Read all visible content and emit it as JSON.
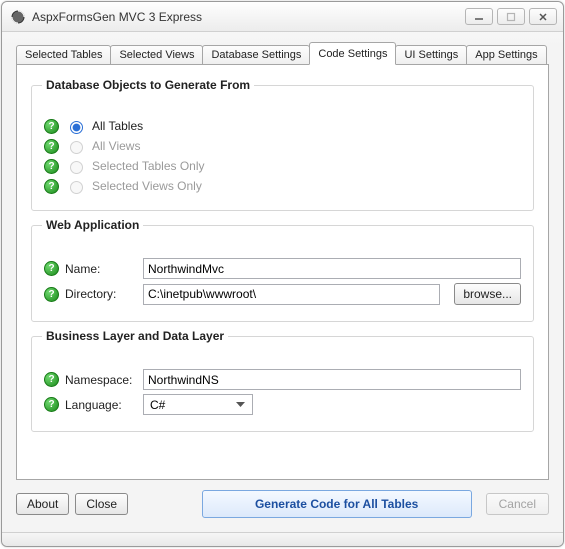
{
  "window": {
    "title": "AspxFormsGen MVC 3 Express"
  },
  "tabs": [
    {
      "label": "Selected Tables"
    },
    {
      "label": "Selected Views"
    },
    {
      "label": "Database Settings"
    },
    {
      "label": "Code Settings"
    },
    {
      "label": "UI Settings"
    },
    {
      "label": "App Settings"
    }
  ],
  "active_tab_index": 3,
  "dbobjects": {
    "title": "Database Objects to Generate From",
    "options": [
      {
        "label": "All Tables",
        "selected": true,
        "enabled": true
      },
      {
        "label": "All Views",
        "selected": false,
        "enabled": false
      },
      {
        "label": "Selected Tables Only",
        "selected": false,
        "enabled": false
      },
      {
        "label": "Selected Views Only",
        "selected": false,
        "enabled": false
      }
    ]
  },
  "webapp": {
    "title": "Web Application",
    "name_label": "Name:",
    "name_value": "NorthwindMvc",
    "dir_label": "Directory:",
    "dir_value": "C:\\inetpub\\wwwroot\\",
    "browse_label": "browse..."
  },
  "layers": {
    "title": "Business Layer and Data Layer",
    "ns_label": "Namespace:",
    "ns_value": "NorthwindNS",
    "lang_label": "Language:",
    "lang_value": "C#"
  },
  "footer": {
    "about": "About",
    "close": "Close",
    "generate": "Generate Code for All Tables",
    "cancel": "Cancel"
  }
}
